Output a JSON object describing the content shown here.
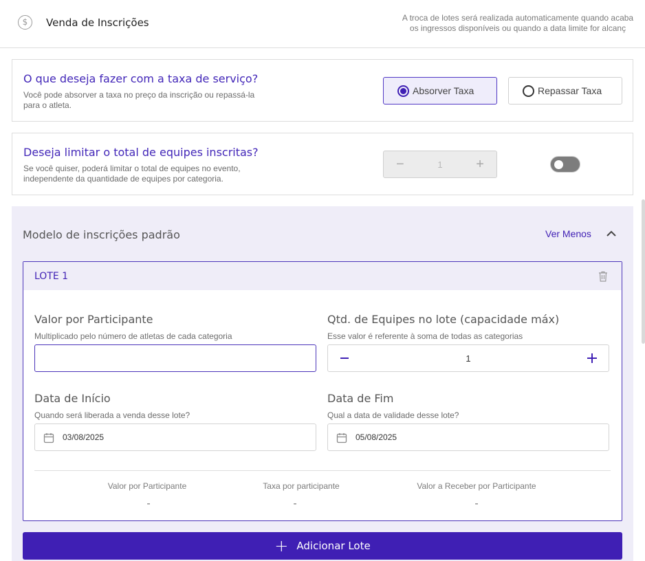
{
  "header": {
    "icon": "dollar-circle-icon",
    "title": "Venda de Inscrições",
    "notice_line1": "A troca de lotes será realizada automaticamente quando acaba",
    "notice_line2": "os ingressos disponíveis ou quando a data limite for alcanç"
  },
  "taxa": {
    "title": "O que deseja fazer com a taxa de serviço?",
    "description": "Você pode absorver a taxa no preço da inscrição ou repassá-la para o atleta.",
    "options": [
      {
        "label": "Absorver Taxa",
        "selected": true
      },
      {
        "label": "Repassar Taxa",
        "selected": false
      }
    ]
  },
  "limite": {
    "title": "Deseja limitar o total de equipes inscritas?",
    "description": "Se você quiser, poderá limitar o total de equipes no evento, independente da quantidade de equipes por categoria.",
    "stepper_value": "1",
    "toggle_on": false
  },
  "modelo": {
    "title": "Modelo de inscrições padrão",
    "toggle_label": "Ver Menos",
    "lote": {
      "title": "LOTE 1",
      "valor": {
        "label": "Valor por Participante",
        "hint": "Multiplicado pelo número de atletas de cada categoria",
        "value": ""
      },
      "qtd": {
        "label": "Qtd. de Equipes no lote (capacidade máx)",
        "hint": "Esse valor é referente à soma de todas as categorias",
        "value": "1"
      },
      "inicio": {
        "label": "Data de Início",
        "hint": "Quando será liberada a venda desse lote?",
        "value": "03/08/2025"
      },
      "fim": {
        "label": "Data de Fim",
        "hint": "Qual a data de validade desse lote?",
        "value": "05/08/2025"
      },
      "summary": [
        {
          "label": "Valor por Participante",
          "value": "-"
        },
        {
          "label": "Taxa por participante",
          "value": "-"
        },
        {
          "label": "Valor a Receber por Participante",
          "value": "-"
        }
      ]
    },
    "add_button": "Adicionar Lote"
  },
  "colors": {
    "primary": "#3f1fb4",
    "section_bg": "#efedf8"
  }
}
